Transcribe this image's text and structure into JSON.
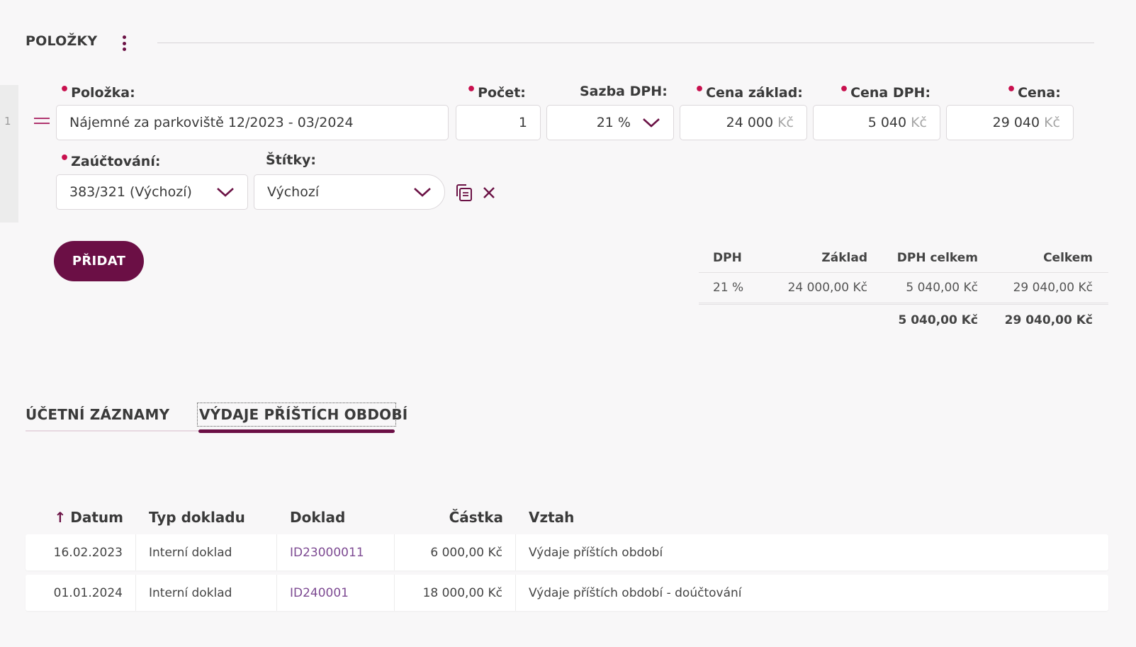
{
  "section": {
    "title": "POLOŽKY"
  },
  "row": {
    "number": "1",
    "labels": {
      "item": "Položka:",
      "count": "Počet:",
      "vat_rate": "Sazba DPH:",
      "base_price": "Cena základ:",
      "vat_price": "Cena DPH:",
      "price": "Cena:",
      "accounting": "Zaúčtování:",
      "tags": "Štítky:"
    },
    "values": {
      "item": "Nájemné za parkoviště 12/2023 - 03/2024",
      "count": "1",
      "vat_rate": "21 %",
      "base_price": "24 000",
      "vat_price": "5 040",
      "price": "29 040",
      "currency": "Kč",
      "accounting": "383/321 (Výchozí)",
      "tags": "Výchozí"
    }
  },
  "add_button": "PŘIDAT",
  "vat_summary": {
    "headers": [
      "DPH",
      "Základ",
      "DPH celkem",
      "Celkem"
    ],
    "rows": [
      [
        "21 %",
        "24 000,00 Kč",
        "5 040,00 Kč",
        "29 040,00 Kč"
      ]
    ],
    "total": [
      "",
      "",
      "5 040,00 Kč",
      "29 040,00 Kč"
    ]
  },
  "tabs": [
    {
      "label": "ÚČETNÍ ZÁZNAMY",
      "active": false
    },
    {
      "label": "VÝDAJE PŘÍŠTÍCH OBDOBÍ",
      "active": true
    }
  ],
  "records": {
    "headers": [
      "Datum",
      "Typ dokladu",
      "Doklad",
      "Částka",
      "Vztah"
    ],
    "sort_icon": "↑",
    "rows": [
      [
        "16.02.2023",
        "Interní doklad",
        "ID23000011",
        "6 000,00 Kč",
        "Výdaje příštích období"
      ],
      [
        "01.01.2024",
        "Interní doklad",
        "ID240001",
        "18 000,00 Kč",
        "Výdaje příštích období - doúčtování"
      ]
    ]
  },
  "colors": {
    "accent": "#6b0f45",
    "required": "#c8104e",
    "link": "#7d4a92"
  }
}
